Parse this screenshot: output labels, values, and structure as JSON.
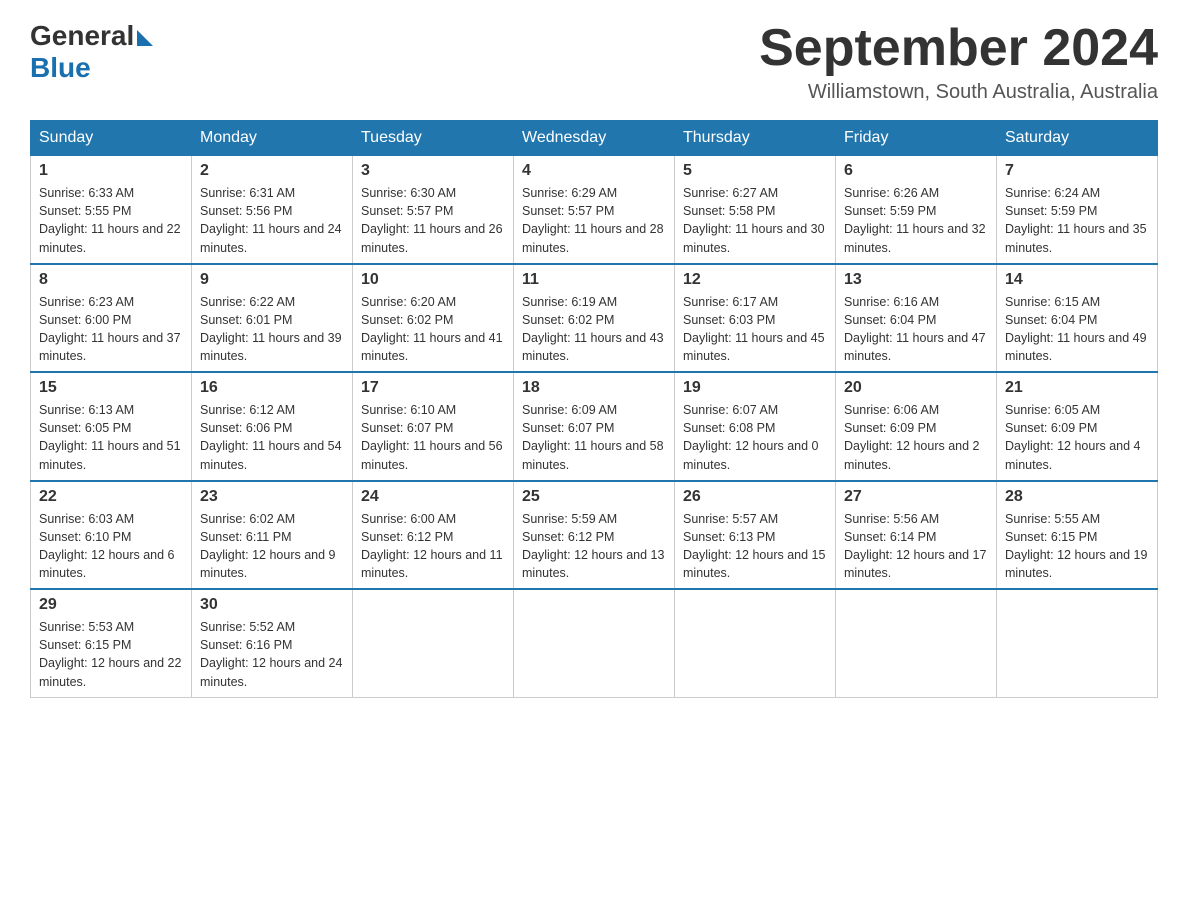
{
  "header": {
    "logo_general": "General",
    "logo_blue": "Blue",
    "month_title": "September 2024",
    "location": "Williamstown, South Australia, Australia"
  },
  "days_of_week": [
    "Sunday",
    "Monday",
    "Tuesday",
    "Wednesday",
    "Thursday",
    "Friday",
    "Saturday"
  ],
  "weeks": [
    [
      {
        "day": "1",
        "sunrise": "6:33 AM",
        "sunset": "5:55 PM",
        "daylight": "11 hours and 22 minutes."
      },
      {
        "day": "2",
        "sunrise": "6:31 AM",
        "sunset": "5:56 PM",
        "daylight": "11 hours and 24 minutes."
      },
      {
        "day": "3",
        "sunrise": "6:30 AM",
        "sunset": "5:57 PM",
        "daylight": "11 hours and 26 minutes."
      },
      {
        "day": "4",
        "sunrise": "6:29 AM",
        "sunset": "5:57 PM",
        "daylight": "11 hours and 28 minutes."
      },
      {
        "day": "5",
        "sunrise": "6:27 AM",
        "sunset": "5:58 PM",
        "daylight": "11 hours and 30 minutes."
      },
      {
        "day": "6",
        "sunrise": "6:26 AM",
        "sunset": "5:59 PM",
        "daylight": "11 hours and 32 minutes."
      },
      {
        "day": "7",
        "sunrise": "6:24 AM",
        "sunset": "5:59 PM",
        "daylight": "11 hours and 35 minutes."
      }
    ],
    [
      {
        "day": "8",
        "sunrise": "6:23 AM",
        "sunset": "6:00 PM",
        "daylight": "11 hours and 37 minutes."
      },
      {
        "day": "9",
        "sunrise": "6:22 AM",
        "sunset": "6:01 PM",
        "daylight": "11 hours and 39 minutes."
      },
      {
        "day": "10",
        "sunrise": "6:20 AM",
        "sunset": "6:02 PM",
        "daylight": "11 hours and 41 minutes."
      },
      {
        "day": "11",
        "sunrise": "6:19 AM",
        "sunset": "6:02 PM",
        "daylight": "11 hours and 43 minutes."
      },
      {
        "day": "12",
        "sunrise": "6:17 AM",
        "sunset": "6:03 PM",
        "daylight": "11 hours and 45 minutes."
      },
      {
        "day": "13",
        "sunrise": "6:16 AM",
        "sunset": "6:04 PM",
        "daylight": "11 hours and 47 minutes."
      },
      {
        "day": "14",
        "sunrise": "6:15 AM",
        "sunset": "6:04 PM",
        "daylight": "11 hours and 49 minutes."
      }
    ],
    [
      {
        "day": "15",
        "sunrise": "6:13 AM",
        "sunset": "6:05 PM",
        "daylight": "11 hours and 51 minutes."
      },
      {
        "day": "16",
        "sunrise": "6:12 AM",
        "sunset": "6:06 PM",
        "daylight": "11 hours and 54 minutes."
      },
      {
        "day": "17",
        "sunrise": "6:10 AM",
        "sunset": "6:07 PM",
        "daylight": "11 hours and 56 minutes."
      },
      {
        "day": "18",
        "sunrise": "6:09 AM",
        "sunset": "6:07 PM",
        "daylight": "11 hours and 58 minutes."
      },
      {
        "day": "19",
        "sunrise": "6:07 AM",
        "sunset": "6:08 PM",
        "daylight": "12 hours and 0 minutes."
      },
      {
        "day": "20",
        "sunrise": "6:06 AM",
        "sunset": "6:09 PM",
        "daylight": "12 hours and 2 minutes."
      },
      {
        "day": "21",
        "sunrise": "6:05 AM",
        "sunset": "6:09 PM",
        "daylight": "12 hours and 4 minutes."
      }
    ],
    [
      {
        "day": "22",
        "sunrise": "6:03 AM",
        "sunset": "6:10 PM",
        "daylight": "12 hours and 6 minutes."
      },
      {
        "day": "23",
        "sunrise": "6:02 AM",
        "sunset": "6:11 PM",
        "daylight": "12 hours and 9 minutes."
      },
      {
        "day": "24",
        "sunrise": "6:00 AM",
        "sunset": "6:12 PM",
        "daylight": "12 hours and 11 minutes."
      },
      {
        "day": "25",
        "sunrise": "5:59 AM",
        "sunset": "6:12 PM",
        "daylight": "12 hours and 13 minutes."
      },
      {
        "day": "26",
        "sunrise": "5:57 AM",
        "sunset": "6:13 PM",
        "daylight": "12 hours and 15 minutes."
      },
      {
        "day": "27",
        "sunrise": "5:56 AM",
        "sunset": "6:14 PM",
        "daylight": "12 hours and 17 minutes."
      },
      {
        "day": "28",
        "sunrise": "5:55 AM",
        "sunset": "6:15 PM",
        "daylight": "12 hours and 19 minutes."
      }
    ],
    [
      {
        "day": "29",
        "sunrise": "5:53 AM",
        "sunset": "6:15 PM",
        "daylight": "12 hours and 22 minutes."
      },
      {
        "day": "30",
        "sunrise": "5:52 AM",
        "sunset": "6:16 PM",
        "daylight": "12 hours and 24 minutes."
      },
      null,
      null,
      null,
      null,
      null
    ]
  ]
}
